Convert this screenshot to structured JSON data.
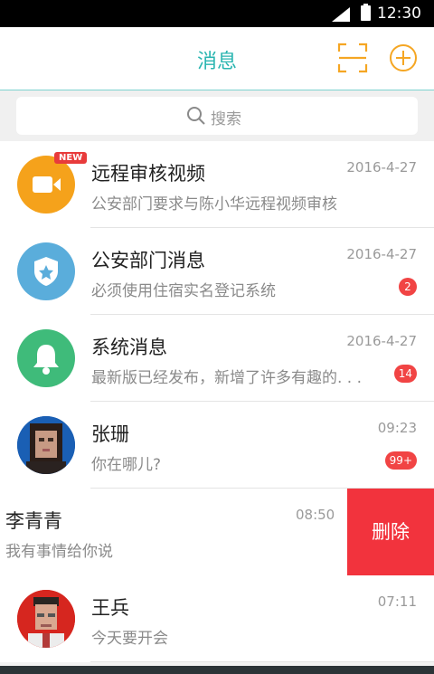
{
  "status_bar": {
    "time": "12:30"
  },
  "header": {
    "title": "消息"
  },
  "search": {
    "placeholder": "搜索"
  },
  "messages": [
    {
      "name": "远程审核视频",
      "preview": "公安部门要求与陈小华远程视频审核",
      "date": "2016-4-27",
      "badge": "",
      "new_label": "NEW",
      "avatar_icon": "video-camera-icon",
      "avatar_color": "#f5a21b"
    },
    {
      "name": "公安部门消息",
      "preview": "必须使用住宿实名登记系统",
      "date": "2016-4-27",
      "badge": "2",
      "avatar_icon": "police-shield-icon",
      "avatar_color": "#5aaddb"
    },
    {
      "name": "系统消息",
      "preview": "最新版已经发布，新增了许多有趣的. . .",
      "date": "2016-4-27",
      "badge": "14",
      "avatar_icon": "bell-icon",
      "avatar_color": "#3fbb7a"
    },
    {
      "name": "张珊",
      "preview": "你在哪儿?",
      "date": "09:23",
      "badge": "99+",
      "avatar_icon": "person-photo-icon",
      "avatar_color": "#1a5fb4"
    },
    {
      "name": "李青青",
      "preview": "我有事情给你说",
      "date": "08:50",
      "action": "删除"
    },
    {
      "name": "王兵",
      "preview": "今天要开会",
      "date": "07:11",
      "badge": "",
      "avatar_icon": "person-photo-icon",
      "avatar_color": "#d6261f"
    }
  ],
  "colors": {
    "accent": "#29b5b0",
    "header_icon": "#f5a623",
    "badge": "#f14444",
    "delete": "#f2333d"
  }
}
